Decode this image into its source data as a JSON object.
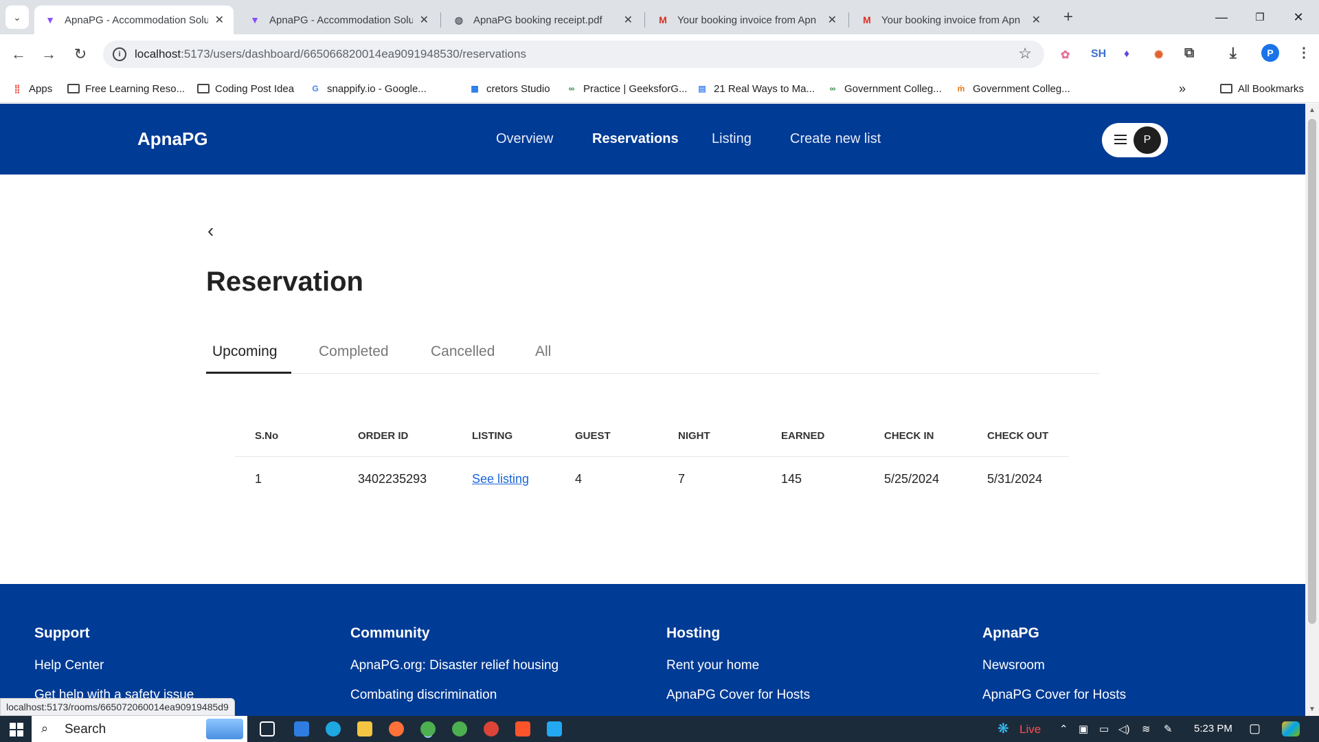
{
  "browser": {
    "tabs": [
      {
        "title": "ApnaPG - Accommodation Solu",
        "active": true,
        "favicon": "vite-icon"
      },
      {
        "title": "ApnaPG - Accommodation Solu",
        "active": false,
        "favicon": "vite-icon"
      },
      {
        "title": "ApnaPG booking receipt.pdf",
        "active": false,
        "favicon": "globe-icon"
      },
      {
        "title": "Your booking invoice from Apn",
        "active": false,
        "favicon": "gmail-icon"
      },
      {
        "title": "Your booking invoice from Apn",
        "active": false,
        "favicon": "gmail-icon"
      }
    ],
    "url_host": "localhost",
    "url_path": ":5173/users/dashboard/665066820014ea9091948530/reservations",
    "profile_initial": "P",
    "extension_label": "SH",
    "bookmarks": [
      {
        "label": "Apps",
        "icon": "apps-grid-icon"
      },
      {
        "label": "Free Learning Reso...",
        "icon": "folder-icon"
      },
      {
        "label": "Coding Post Idea",
        "icon": "folder-icon"
      },
      {
        "label": "snappify.io - Google...",
        "icon": "google-icon"
      },
      {
        "label": "cretors Studio",
        "icon": "calendar-icon"
      },
      {
        "label": "Practice | GeeksforG...",
        "icon": "gfg-icon"
      },
      {
        "label": "21 Real Ways to Ma...",
        "icon": "docs-icon"
      },
      {
        "label": "Government Colleg...",
        "icon": "gfg-icon"
      },
      {
        "label": "Government Colleg...",
        "icon": "mh-icon"
      }
    ],
    "all_bookmarks": "All Bookmarks",
    "status_url": "localhost:5173/rooms/665072060014ea90919485d9"
  },
  "app": {
    "logo": "ApnaPG",
    "nav": [
      "Overview",
      "Reservations",
      "Listing",
      "Create new list"
    ],
    "active_nav": "Reservations",
    "avatar_initial": "P"
  },
  "page": {
    "title": "Reservation",
    "tabs": [
      "Upcoming",
      "Completed",
      "Cancelled",
      "All"
    ],
    "active_tab": "Upcoming",
    "table": {
      "headers": [
        "S.No",
        "ORDER ID",
        "LISTING",
        "GUEST",
        "NIGHT",
        "EARNED",
        "CHECK IN",
        "CHECK OUT"
      ],
      "rows": [
        [
          "1",
          "3402235293",
          "See listing",
          "4",
          "7",
          "145",
          "5/25/2024",
          "5/31/2024"
        ]
      ]
    }
  },
  "footer": {
    "columns": [
      {
        "heading": "Support",
        "links": [
          "Help Center",
          "Get help with a safety issue"
        ]
      },
      {
        "heading": "Community",
        "links": [
          "ApnaPG.org: Disaster relief housing",
          "Combating discrimination"
        ]
      },
      {
        "heading": "Hosting",
        "links": [
          "Rent your home",
          "ApnaPG Cover for Hosts"
        ]
      },
      {
        "heading": "ApnaPG",
        "links": [
          "Newsroom",
          "ApnaPG Cover for Hosts"
        ]
      }
    ]
  },
  "taskbar": {
    "search_placeholder": "Search",
    "live_label": "Live",
    "time": "5:23 PM"
  },
  "colors": {
    "brand_blue": "#003b95",
    "link_blue": "#1a66d9"
  }
}
